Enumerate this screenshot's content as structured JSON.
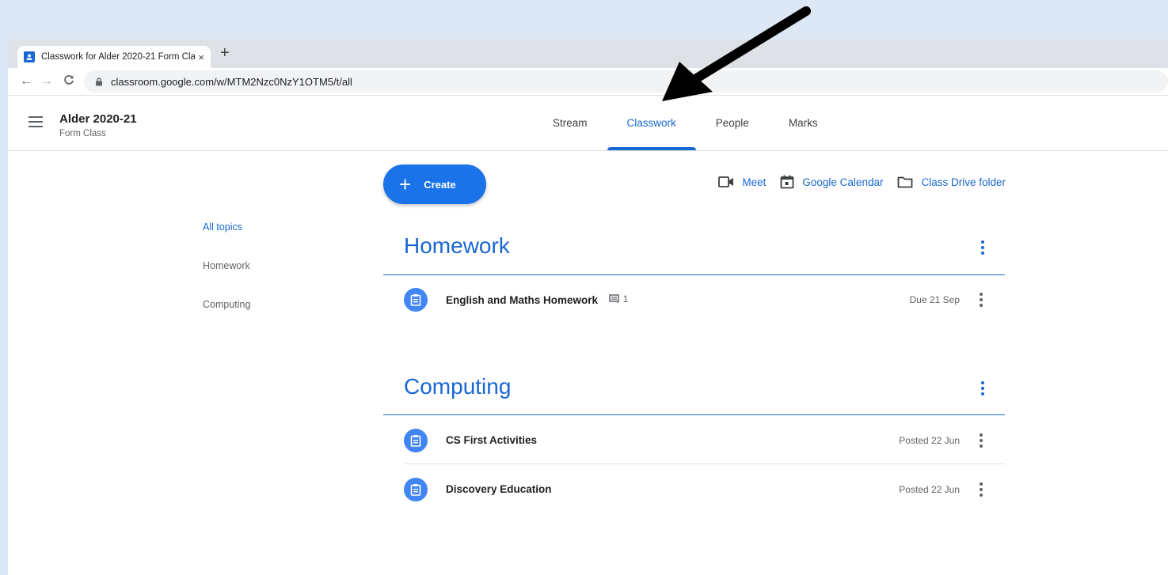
{
  "browser": {
    "tab_title": "Classwork for Alder 2020-21 Form Class",
    "tab_close": "×",
    "new_tab": "+",
    "url": "classroom.google.com/w/MTM2Nzc0NzY1OTM5/t/all"
  },
  "header": {
    "class_name": "Alder 2020-21",
    "class_subtitle": "Form Class",
    "tabs": [
      {
        "label": "Stream"
      },
      {
        "label": "Classwork",
        "active": true
      },
      {
        "label": "People"
      },
      {
        "label": "Marks"
      }
    ]
  },
  "actions": {
    "create": "Create",
    "meet": "Meet",
    "calendar": "Google Calendar",
    "drive": "Class Drive folder"
  },
  "topics": [
    {
      "label": "All topics",
      "active": true
    },
    {
      "label": "Homework"
    },
    {
      "label": "Computing"
    }
  ],
  "sections": [
    {
      "title": "Homework",
      "items": [
        {
          "title": "English and Maths Homework",
          "comments": "1",
          "date": "Due 21 Sep"
        }
      ]
    },
    {
      "title": "Computing",
      "items": [
        {
          "title": "CS First Activities",
          "date": "Posted 22 Jun"
        },
        {
          "title": "Discovery Education",
          "date": "Posted 22 Jun"
        }
      ]
    }
  ],
  "colors": {
    "accent": "#1967d2",
    "create_button": "#1a73e8",
    "assignment_icon": "#4285f4",
    "page_background": "#dce8f5"
  },
  "icons": {
    "favicon": "classroom-icon",
    "lock": "lock-icon",
    "meet": "video-camera-icon",
    "calendar": "calendar-icon",
    "drive": "folder-icon",
    "assignment": "assignment-icon",
    "comments": "comment-icon"
  }
}
